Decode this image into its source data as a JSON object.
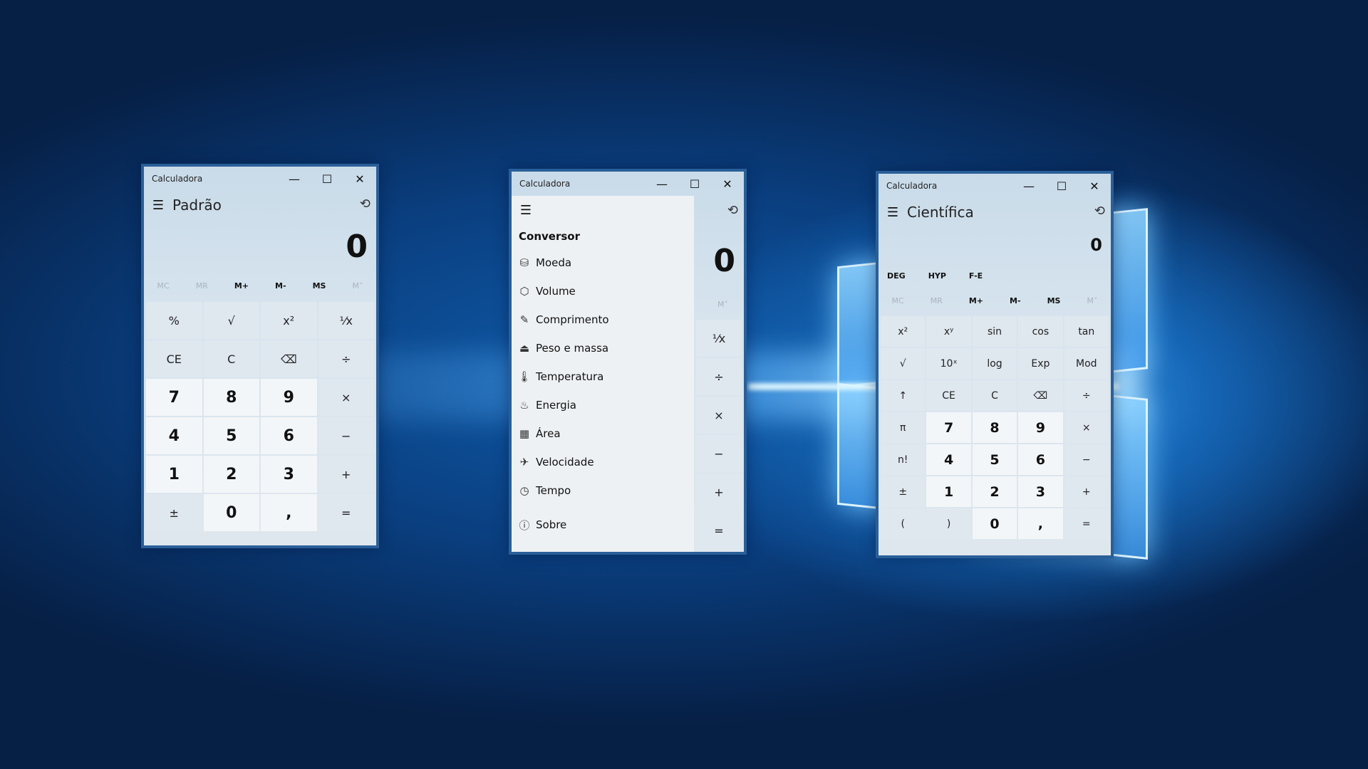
{
  "standard": {
    "title": "Calculadora",
    "mode": "Padrão",
    "display": "0",
    "memory": [
      "MC",
      "MR",
      "M+",
      "M-",
      "MS",
      "M˅"
    ],
    "keys": [
      "%",
      "√",
      "x²",
      "⅟x",
      "CE",
      "C",
      "⌫",
      "÷",
      "7",
      "8",
      "9",
      "×",
      "4",
      "5",
      "6",
      "−",
      "1",
      "2",
      "3",
      "+",
      "±",
      "0",
      ",",
      "="
    ]
  },
  "converter": {
    "title": "Calculadora",
    "section": "Conversor",
    "items": [
      {
        "label": "Moeda",
        "icon": "currency-icon"
      },
      {
        "label": "Volume",
        "icon": "volume-icon"
      },
      {
        "label": "Comprimento",
        "icon": "ruler-icon"
      },
      {
        "label": "Peso e massa",
        "icon": "weight-icon"
      },
      {
        "label": "Temperatura",
        "icon": "thermometer-icon"
      },
      {
        "label": "Energia",
        "icon": "energy-icon"
      },
      {
        "label": "Área",
        "icon": "area-icon"
      },
      {
        "label": "Velocidade",
        "icon": "speed-icon"
      },
      {
        "label": "Tempo",
        "icon": "clock-icon"
      }
    ],
    "about": "Sobre",
    "display": "0",
    "memory_more": "M˅",
    "keys": [
      "⅟x",
      "÷",
      "×",
      "−",
      "+",
      "="
    ]
  },
  "scientific": {
    "title": "Calculadora",
    "mode": "Científica",
    "display": "0",
    "toggles": [
      "DEG",
      "HYP",
      "F-E"
    ],
    "memory": [
      "MC",
      "MR",
      "M+",
      "M-",
      "MS",
      "M˅"
    ],
    "keys": [
      "x²",
      "xʸ",
      "sin",
      "cos",
      "tan",
      "√",
      "10ˣ",
      "log",
      "Exp",
      "Mod",
      "↑",
      "CE",
      "C",
      "⌫",
      "÷",
      "π",
      "7",
      "8",
      "9",
      "×",
      "n!",
      "4",
      "5",
      "6",
      "−",
      "±",
      "1",
      "2",
      "3",
      "+",
      "(",
      ")",
      "0",
      ",",
      "="
    ]
  },
  "window_controls": {
    "minimize": "—",
    "maximize": "☐",
    "close": "✕"
  }
}
